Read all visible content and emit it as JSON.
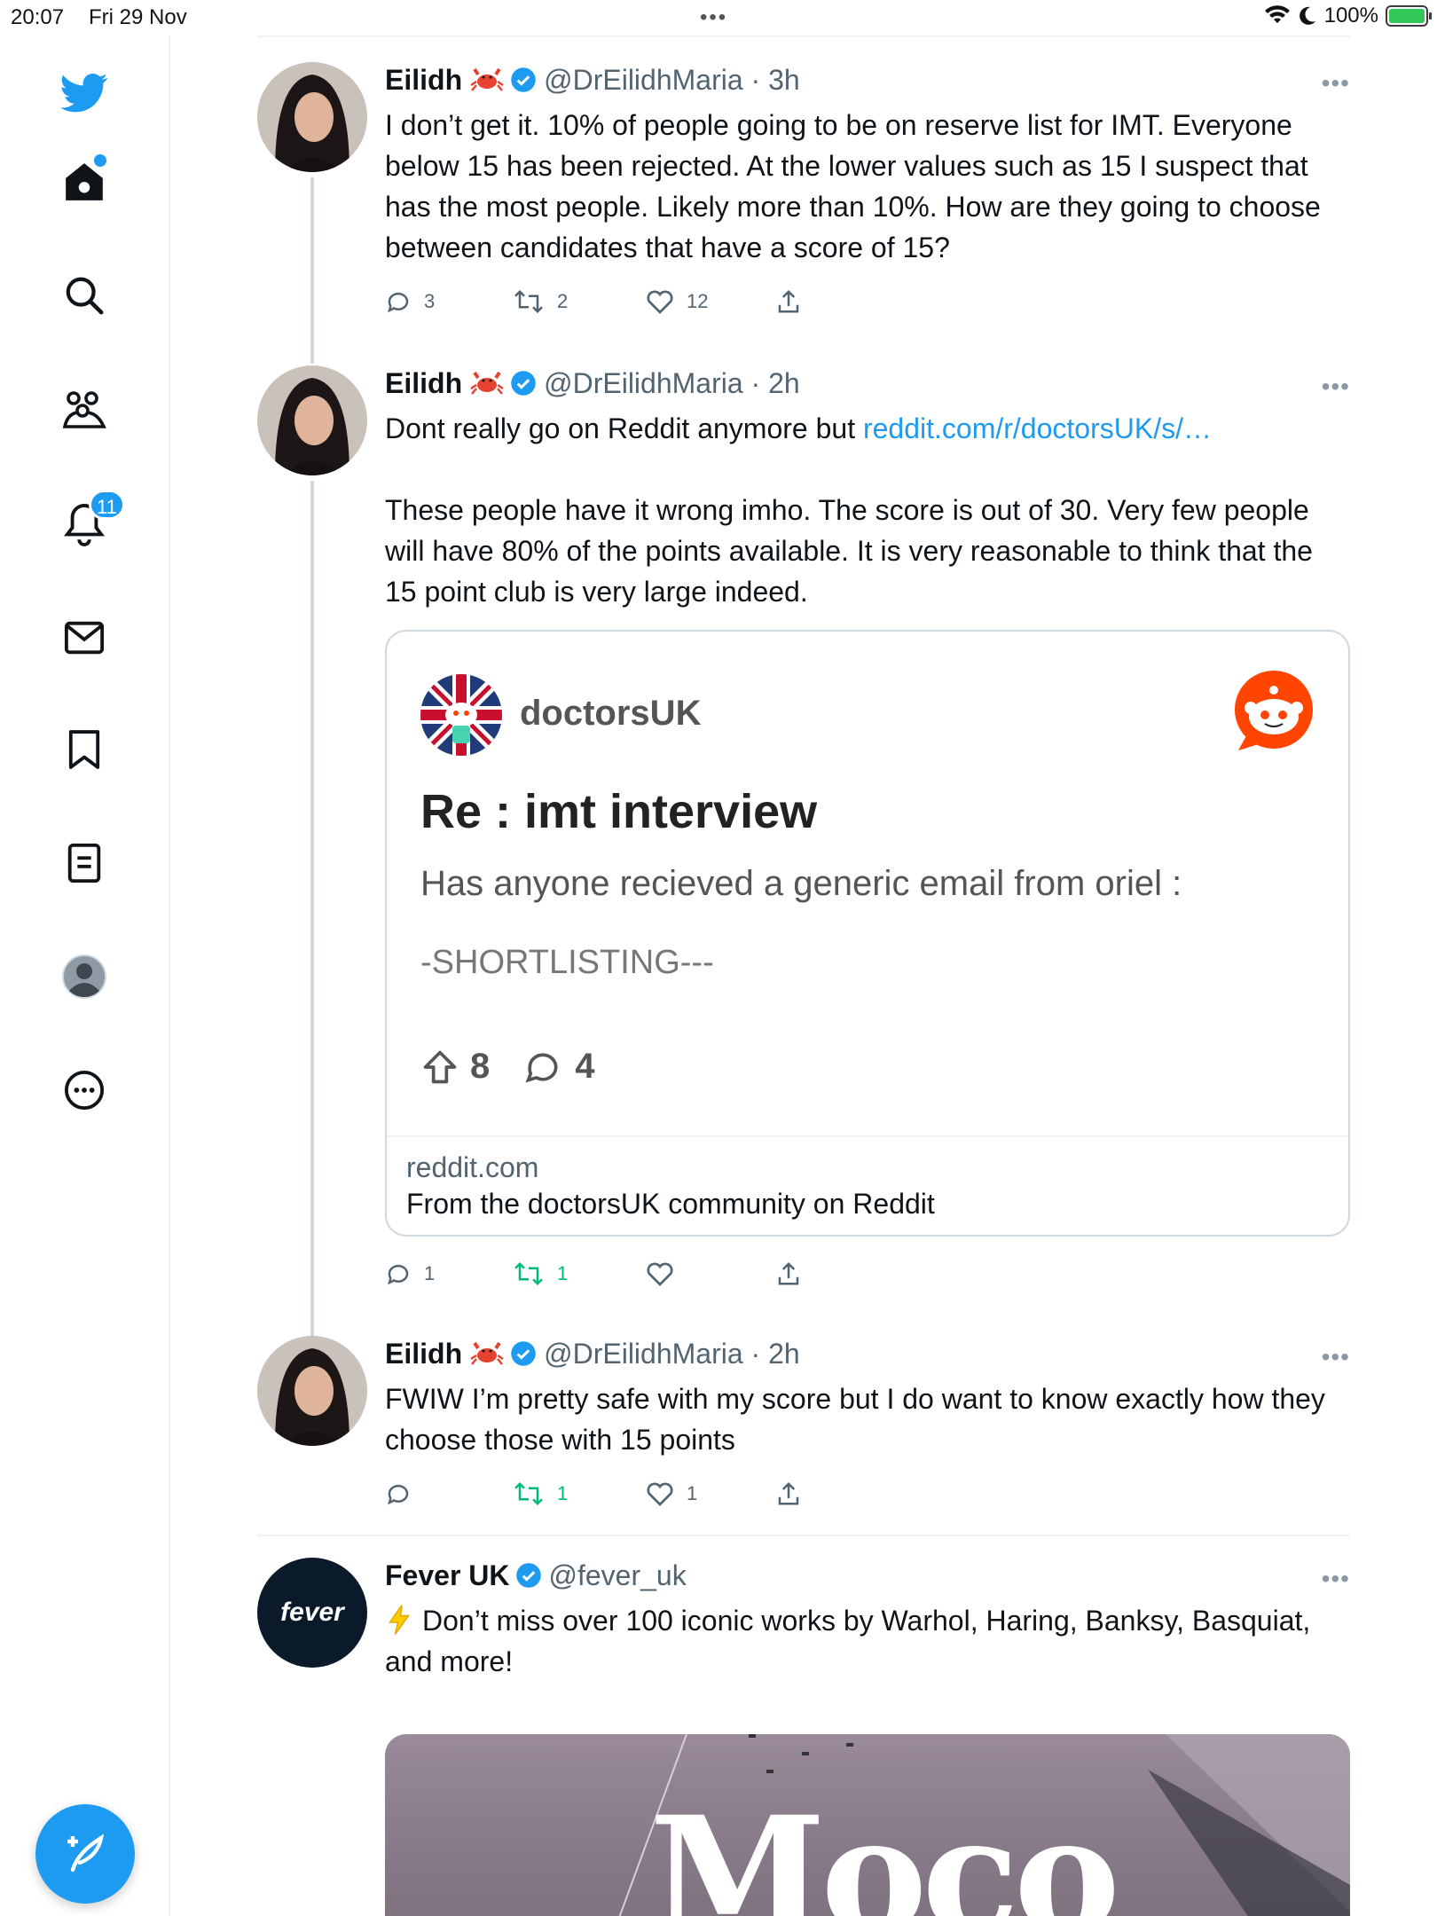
{
  "status_bar": {
    "time": "20:07",
    "date": "Fri 29 Nov",
    "battery": "100%"
  },
  "sidebar": {
    "notifications_badge": "11"
  },
  "tweets": [
    {
      "name": "Eilidh",
      "emoji": "crab-emoji",
      "handle": "@DrEilidhMaria · 3h",
      "text": "I don’t get it. 10% of people going to be on reserve list for IMT. Everyone below 15 has been rejected. At the lower values such as 15 I suspect that has the most people. Likely more than 10%. How are they going to choose between candidates that have a score of 15?",
      "replies": "3",
      "retweets": "2",
      "likes": "12"
    },
    {
      "name": "Eilidh",
      "emoji": "crab-emoji",
      "handle": "@DrEilidhMaria · 2h",
      "text_pre": "Dont really go on Reddit anymore but ",
      "link": "reddit.com/r/doctorsUK/s/…",
      "text_post": "These people have it wrong imho. The score is out of 30. Very few people will have 80% of the points available. It is very reasonable to think that the 15 point club is very large indeed.",
      "replies": "1",
      "retweets": "1",
      "likes": "",
      "card": {
        "subreddit": "doctorsUK",
        "title": "Re : imt interview",
        "line1": "Has anyone recieved a generic email from oriel :",
        "line2": "-SHORTLISTING---",
        "upvotes": "8",
        "comments": "4",
        "domain": "reddit.com",
        "description": "From the doctorsUK community on Reddit"
      }
    },
    {
      "name": "Eilidh",
      "emoji": "crab-emoji",
      "handle": "@DrEilidhMaria · 2h",
      "text": "FWIW I’m pretty safe with my score but I do want to know exactly how they choose those with 15 points",
      "replies": "",
      "retweets": "1",
      "likes": "1"
    },
    {
      "name": "Fever UK",
      "handle": "@fever_uk",
      "avatar_text": "fever",
      "text": "Don’t miss over 100 iconic works by Warhol, Haring, Banksy, Basquiat, and more!",
      "media_text": "Moco"
    }
  ],
  "colors": {
    "accent": "#1d9bf0",
    "retweet_green": "#00ba7c",
    "reddit_orange": "#ff4500",
    "muted": "#536471"
  }
}
